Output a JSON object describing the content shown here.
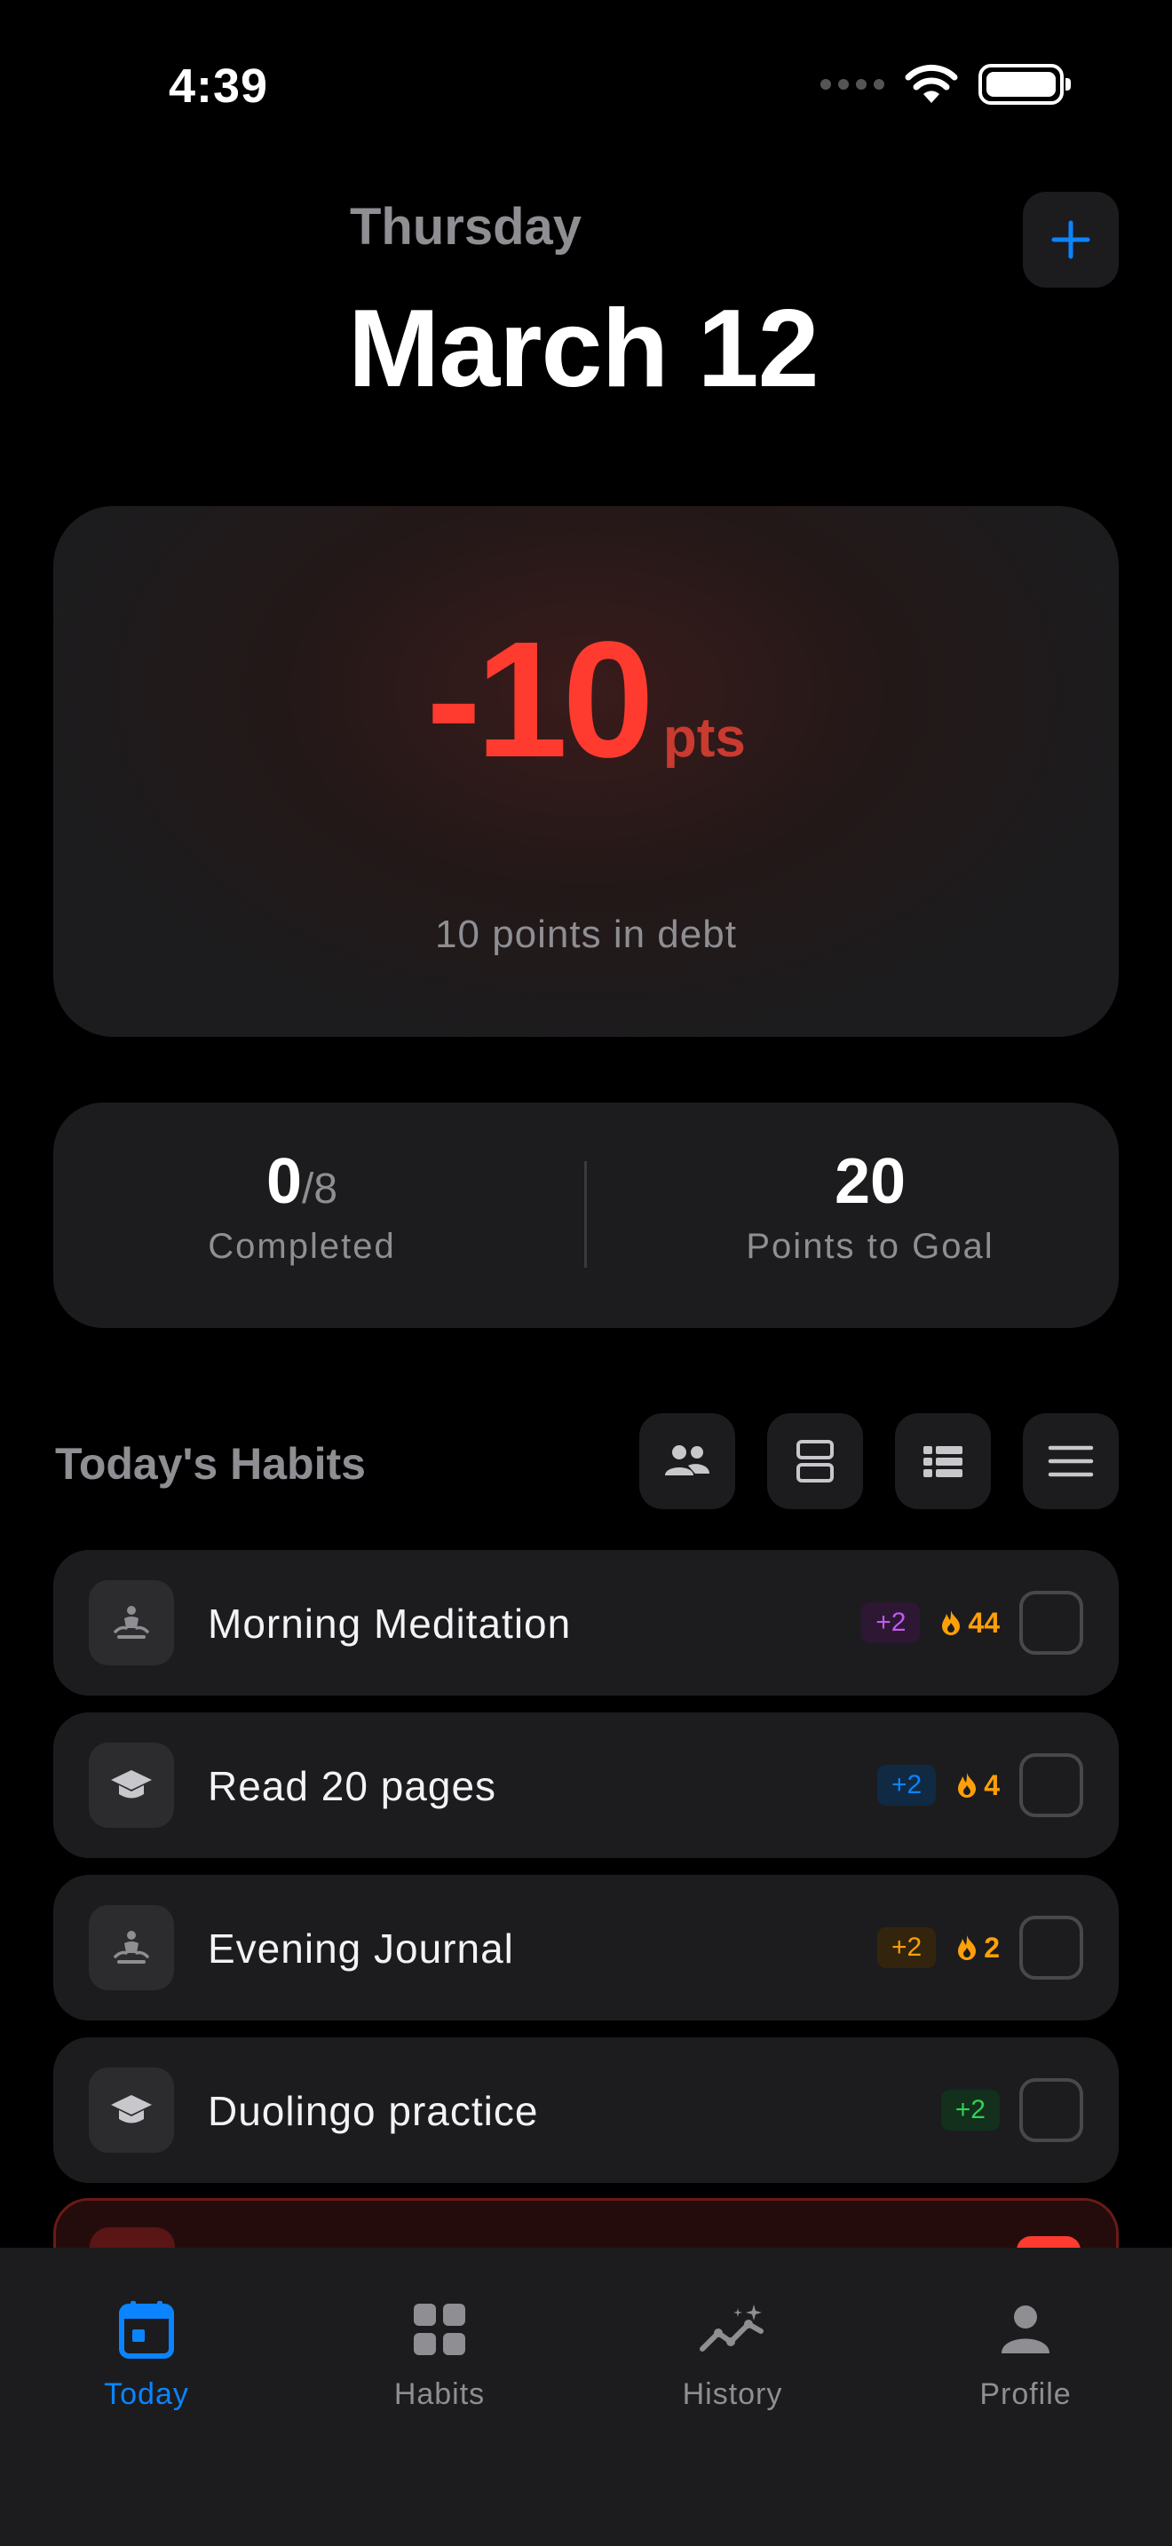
{
  "status_bar": {
    "time": "4:39"
  },
  "header": {
    "weekday": "Thursday",
    "date": "March 12",
    "add_icon": "plus-icon"
  },
  "score": {
    "value": "-10",
    "unit": "pts",
    "caption": "10 points in debt",
    "color": "#ff3b30"
  },
  "stats": {
    "completed": {
      "value": "0",
      "total": "/8",
      "label": "Completed"
    },
    "goal": {
      "value": "20",
      "label": "Points to Goal"
    }
  },
  "habits_section": {
    "title": "Today's Habits",
    "view_buttons": [
      "people-icon",
      "split-view-icon",
      "list-view-icon",
      "menu-icon"
    ]
  },
  "habits": [
    {
      "name": "Morning Meditation",
      "icon": "meditation-icon",
      "points": "+2",
      "points_color": "#bf5af2",
      "points_bg": "#2d1733",
      "streak": "44"
    },
    {
      "name": "Read 20 pages",
      "icon": "graduation-cap-icon",
      "points": "+2",
      "points_color": "#0a84ff",
      "points_bg": "#102a44",
      "streak": "4"
    },
    {
      "name": "Evening Journal",
      "icon": "meditation-icon",
      "points": "+2",
      "points_color": "#ff9f0a",
      "points_bg": "#33250d",
      "streak": "2"
    },
    {
      "name": "Duolingo practice",
      "icon": "graduation-cap-icon",
      "points": "+2",
      "points_color": "#30d158",
      "points_bg": "#12301b",
      "streak": ""
    }
  ],
  "tabs": [
    {
      "label": "Today",
      "icon": "calendar-icon",
      "active": true
    },
    {
      "label": "Habits",
      "icon": "grid-icon",
      "active": false
    },
    {
      "label": "History",
      "icon": "chart-sparkle-icon",
      "active": false
    },
    {
      "label": "Profile",
      "icon": "person-icon",
      "active": false
    }
  ],
  "colors": {
    "accent": "#0a84ff",
    "negative": "#ff3b30",
    "streak": "#ff9f0a"
  }
}
